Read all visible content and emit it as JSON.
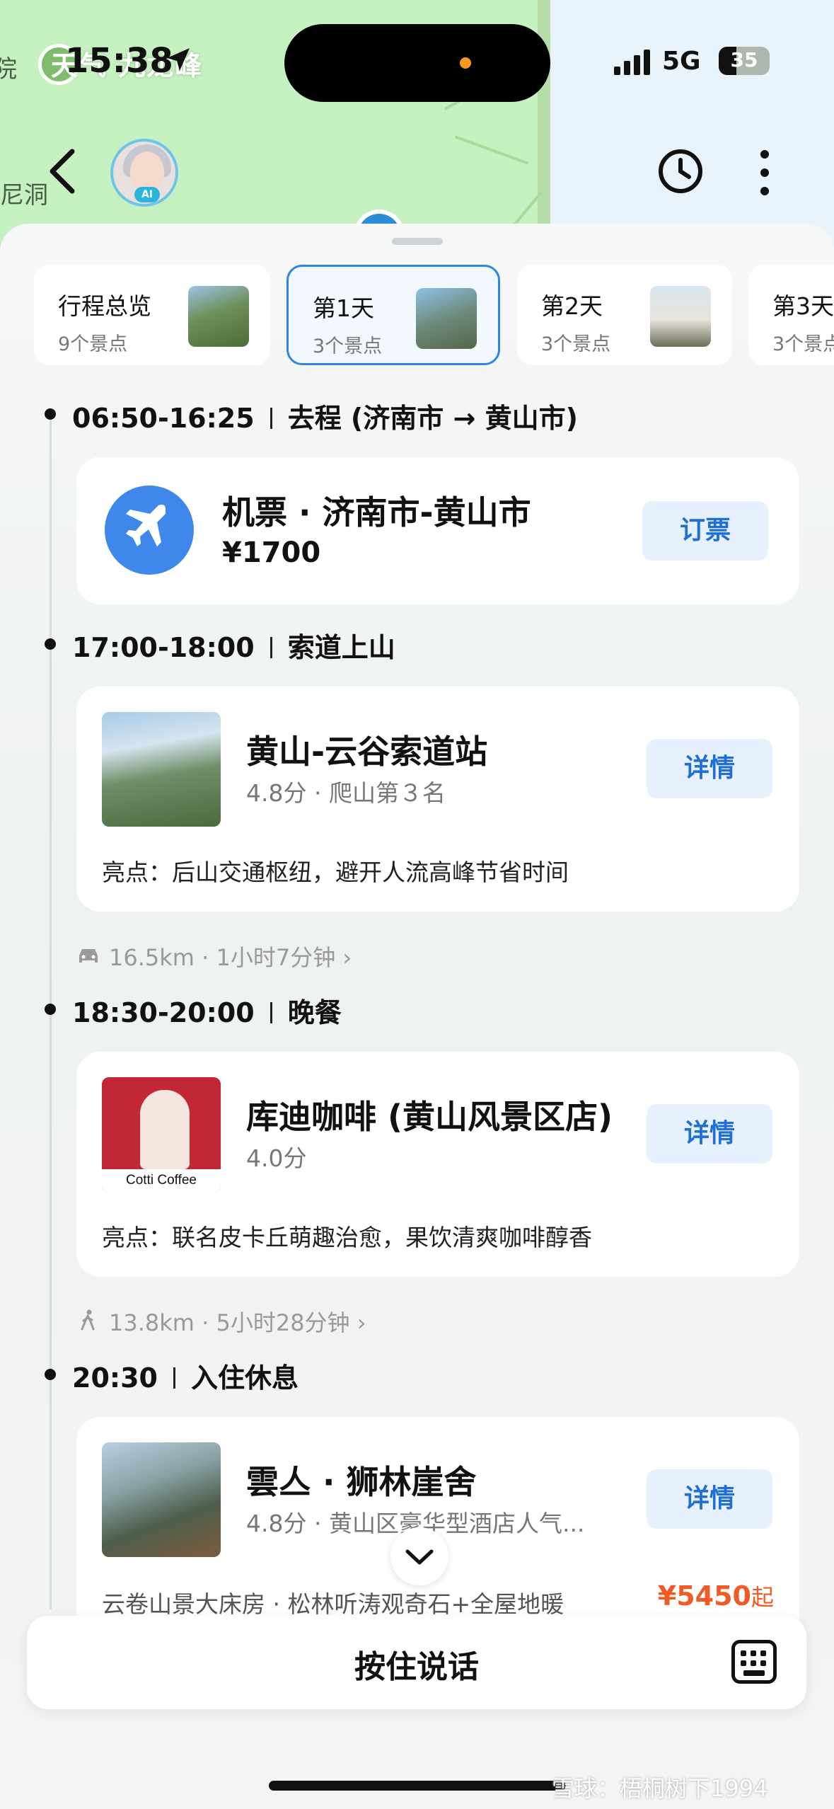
{
  "status": {
    "time": "15:38",
    "network": "5G",
    "battery": "35"
  },
  "map": {
    "peak_label": "天气 九龙峰",
    "cave_label": "尼洞",
    "left_label": "院"
  },
  "header": {
    "avatar_badge": "AI"
  },
  "tabs": [
    {
      "title": "行程总览",
      "subtitle": "9个景点"
    },
    {
      "title": "第1天",
      "subtitle": "3个景点"
    },
    {
      "title": "第2天",
      "subtitle": "3个景点"
    },
    {
      "title": "第3天",
      "subtitle": "3个景点"
    }
  ],
  "timeline": [
    {
      "time": "06:50-16:25",
      "label": "去程 (济南市 → 黄山市)",
      "card": {
        "title": "机票 · 济南市-黄山市",
        "price": "¥1700",
        "button": "订票"
      }
    },
    {
      "time": "17:00-18:00",
      "label": "索道上山",
      "card": {
        "title": "黄山-云谷索道站",
        "subtitle": "4.8分 · 爬山第３名",
        "highlight": "亮点：后山交通枢纽，避开人流高峰节省时间",
        "button": "详情"
      }
    },
    {
      "transit": "16.5km · 1小时7分钟 ›"
    },
    {
      "time": "18:30-20:00",
      "label": "晚餐",
      "card": {
        "title": "库迪咖啡 (黄山风景区店)",
        "subtitle": "4.0分",
        "logo_text": "Cotti Coffee",
        "highlight": "亮点：联名皮卡丘萌趣治愈，果饮清爽咖啡醇香",
        "button": "详情"
      }
    },
    {
      "transit": "13.8km · 5小时28分钟 ›"
    },
    {
      "time": "20:30",
      "label": "入住休息",
      "card": {
        "title": "雲亼 · 狮林崖舍",
        "subtitle": "4.8分 · 黄山区豪华型酒店人气...",
        "room": "云卷山景大床房 · 松林听涛观奇石+全屋地暖",
        "price": "¥5450",
        "price_suffix": "起",
        "button": "详情"
      }
    }
  ],
  "voice": {
    "label": "按住说话"
  },
  "watermark": "雪球：梧桐树下1994",
  "colors": {
    "accent": "#2f86e0",
    "price": "#f05a24",
    "flight_icon_bg": "#3f87ea"
  }
}
